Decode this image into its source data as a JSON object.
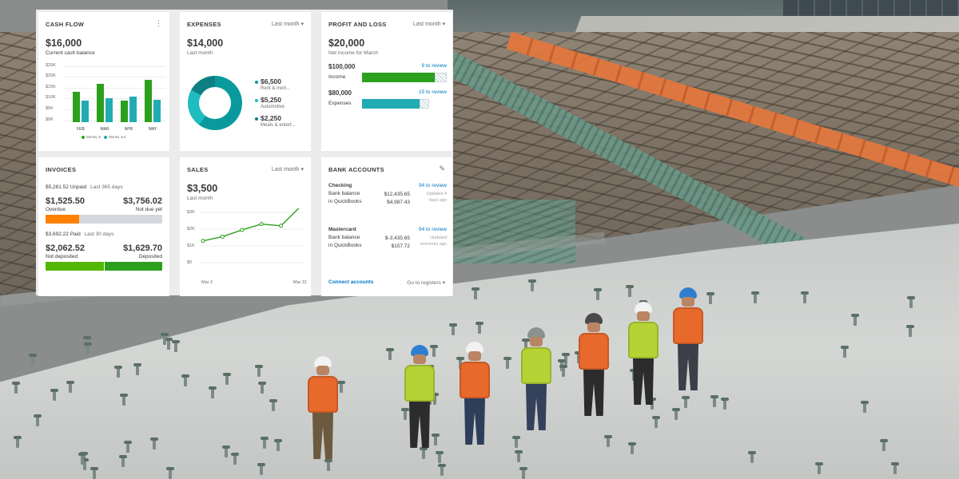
{
  "cash_flow": {
    "title": "CASH FLOW",
    "amount": "$16,000",
    "subtitle": "Current cash balance",
    "y_ticks": [
      "$25K",
      "$20K",
      "$15K",
      "$10K",
      "$5K",
      "$0K"
    ],
    "months": [
      "FEB",
      "MAR",
      "APR",
      "MAY"
    ],
    "legend_in": "Money in",
    "legend_out": "Money out",
    "colors": {
      "in": "#2ca01c",
      "out": "#21abb3"
    }
  },
  "expenses": {
    "title": "EXPENSES",
    "period": "Last month",
    "amount": "$14,000",
    "subtitle": "Last month",
    "items": [
      {
        "amount": "$6,500",
        "label": "Rent & mort..."
      },
      {
        "amount": "$5,250",
        "label": "Automotive"
      },
      {
        "amount": "$2,250",
        "label": "Meals & entert..."
      }
    ]
  },
  "profit_loss": {
    "title": "PROFIT AND LOSS",
    "period": "Last month",
    "amount": "$20,000",
    "subtitle": "Net income for March",
    "income": {
      "amount": "$100,000",
      "label": "Income",
      "review": "8 to review"
    },
    "expenses": {
      "amount": "$80,000",
      "label": "Expenses",
      "review": "15 to review"
    }
  },
  "invoices": {
    "title": "INVOICES",
    "unpaid_amount": "$5,281.52 Unpaid",
    "unpaid_period": "Last 365 days",
    "overdue_amount": "$1,525.50",
    "overdue_label": "Overdue",
    "notdue_amount": "$3,756.02",
    "notdue_label": "Not due yet",
    "paid_amount": "$3,692.22 Paid",
    "paid_period": "Last 30 days",
    "notdeposited_amount": "$2,062.52",
    "notdeposited_label": "Not deposited",
    "deposited_amount": "$1,629.70",
    "deposited_label": "Deposited"
  },
  "sales": {
    "title": "SALES",
    "period": "Last month",
    "amount": "$3,500",
    "subtitle": "Last month",
    "y_ticks": [
      "$3K",
      "$2K",
      "$1K",
      "$0"
    ],
    "x_start": "Mar 2",
    "x_end": "Mar 31"
  },
  "bank_accounts": {
    "title": "BANK ACCOUNTS",
    "checking": {
      "name": "Checking",
      "review": "94 to review",
      "bank_label": "Bank balance",
      "qb_label": "in QuickBooks",
      "bank_balance": "$12,435.65",
      "qb_balance": "$4,987.43",
      "updated": "Updated 4 days ago"
    },
    "mastercard": {
      "name": "Mastercard",
      "review": "94 to review",
      "bank_label": "Bank balance",
      "qb_label": "in QuickBooks",
      "bank_balance": "$-3,435.65",
      "qb_balance": "$157.72",
      "updated": "Updated moments ago"
    },
    "connect": "Connect accounts",
    "registers": "Go to registers"
  },
  "chart_data": [
    {
      "type": "bar",
      "title": "CASH FLOW",
      "categories": [
        "FEB",
        "MAR",
        "APR",
        "MAY"
      ],
      "ylim": [
        0,
        25000
      ],
      "series": [
        {
          "name": "Money in",
          "values": [
            17000,
            21500,
            12000,
            23500
          ]
        },
        {
          "name": "Money out",
          "values": [
            12000,
            13500,
            14500,
            12500
          ]
        }
      ]
    },
    {
      "type": "line",
      "title": "SALES",
      "x": [
        "Mar 2",
        "",
        "",
        "",
        "",
        "Mar 31"
      ],
      "ylim": [
        0,
        3500
      ],
      "series": [
        {
          "values": [
            1300,
            1550,
            1950,
            2300,
            2200,
            3350
          ]
        }
      ]
    },
    {
      "type": "pie",
      "title": "EXPENSES",
      "categories": [
        "Rent & mort...",
        "Automotive",
        "Meals & entert..."
      ],
      "values": [
        6500,
        5250,
        2250
      ]
    }
  ]
}
